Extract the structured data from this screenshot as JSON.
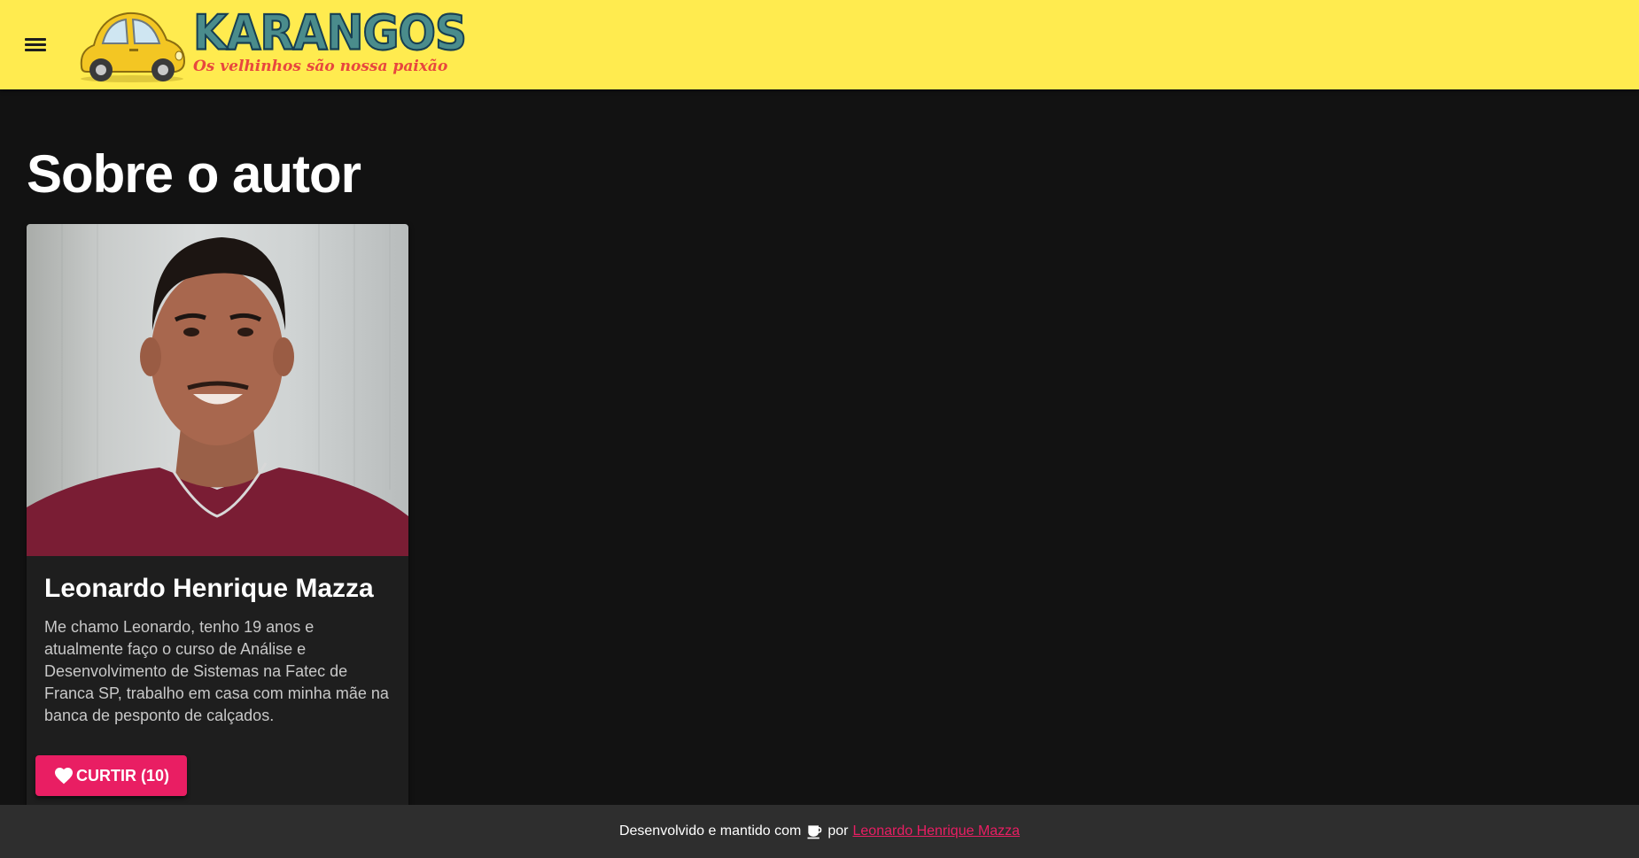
{
  "header": {
    "menu_icon": "menu-icon",
    "logo_title": "KARANGOS",
    "logo_tagline": "Os velhinhos são nossa paixão",
    "background_color": "#ffeb4f"
  },
  "page": {
    "title": "Sobre o autor"
  },
  "author_card": {
    "name": "Leonardo Henrique Mazza",
    "bio": "Me chamo Leonardo, tenho 19 anos e atualmente faço o curso de Análise e Desenvolvimento de Sistemas na Fatec de Franca SP, trabalho em casa com minha mãe na banca de pesponto de calçados.",
    "like_label": "CURTIR (10)",
    "like_icon": "heart-icon",
    "accent_color": "#e91e63"
  },
  "footer": {
    "text_before": "Desenvolvido e mantido com",
    "icon": "coffee-icon",
    "text_por": "por",
    "link_text": "Leonardo Henrique Mazza"
  }
}
